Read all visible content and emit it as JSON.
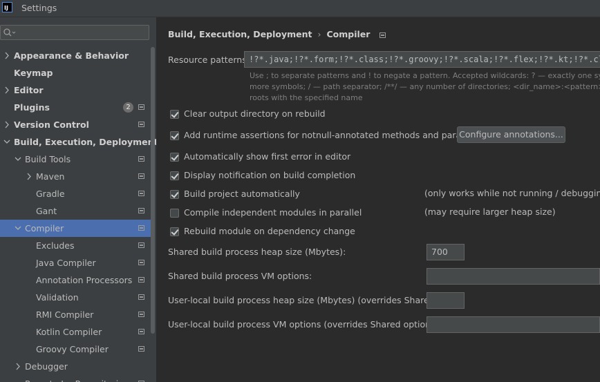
{
  "window": {
    "title": "Settings",
    "app_icon_text": "IJ"
  },
  "sidebar": {
    "search_value": "",
    "items": [
      {
        "label": "Appearance & Behavior",
        "bold": true,
        "chevron": "right"
      },
      {
        "label": "Keymap",
        "bold": true
      },
      {
        "label": "Editor",
        "bold": true,
        "chevron": "right"
      },
      {
        "label": "Plugins",
        "bold": true,
        "badge": "2",
        "page_icon": true
      },
      {
        "label": "Version Control",
        "bold": true,
        "chevron": "right",
        "page_icon": true
      },
      {
        "label": "Build, Execution, Deployment",
        "bold": true,
        "chevron": "down"
      },
      {
        "label": "Build Tools",
        "chevron": "down",
        "page_icon": true
      },
      {
        "label": "Maven",
        "chevron": "right",
        "page_icon": true
      },
      {
        "label": "Gradle",
        "page_icon": true
      },
      {
        "label": "Gant",
        "page_icon": true
      },
      {
        "label": "Compiler",
        "chevron": "down",
        "page_icon": true,
        "selected": true
      },
      {
        "label": "Excludes",
        "page_icon": true
      },
      {
        "label": "Java Compiler",
        "page_icon": true
      },
      {
        "label": "Annotation Processors",
        "page_icon": true
      },
      {
        "label": "Validation",
        "page_icon": true
      },
      {
        "label": "RMI Compiler",
        "page_icon": true
      },
      {
        "label": "Kotlin Compiler",
        "page_icon": true
      },
      {
        "label": "Groovy Compiler",
        "page_icon": true
      },
      {
        "label": "Debugger",
        "chevron": "right"
      },
      {
        "label": "Remote Jar Repositories",
        "page_icon": true
      }
    ]
  },
  "breadcrumb": {
    "parent": "Build, Execution, Deployment",
    "separator": "›",
    "current": "Compiler"
  },
  "resource_patterns": {
    "label": "Resource patterns:",
    "value": "!?*.java;!?*.form;!?*.class;!?*.groovy;!?*.scala;!?*.flex;!?*.kt;!?*.clj;",
    "hint_lines": [
      "Use ; to separate patterns and ! to negate a pattern. Accepted wildcards: ? — exactly one symbol; * — zero or",
      "more symbols; / — path separator; /**/ — any number of directories; <dir_name>:<pattern> — restrict to source",
      "roots with the specified name"
    ]
  },
  "options": [
    {
      "label": "Clear output directory on rebuild",
      "checked": true
    },
    {
      "label": "Add runtime assertions for notnull-annotated methods and parameters",
      "checked": true
    },
    {
      "label": "Automatically show first error in editor",
      "checked": true
    },
    {
      "label": "Display notification on build completion",
      "checked": true
    },
    {
      "label": "Build project automatically",
      "checked": true,
      "note": "(only works while not running / debugging)"
    },
    {
      "label": "Compile independent modules in parallel",
      "checked": false,
      "note": "(may require larger heap size)"
    },
    {
      "label": "Rebuild module on dependency change",
      "checked": true
    }
  ],
  "configure_button_label": "Configure annotations...",
  "fields": {
    "heap_label": "Shared build process heap size (Mbytes):",
    "heap_value": "700",
    "vm_label": "Shared build process VM options:",
    "vm_value": "",
    "user_heap_label": "User-local build process heap size (Mbytes) (overrides Shared size):",
    "user_heap_value": "",
    "user_vm_label": "User-local build process VM options (overrides Shared options):",
    "user_vm_value": ""
  }
}
